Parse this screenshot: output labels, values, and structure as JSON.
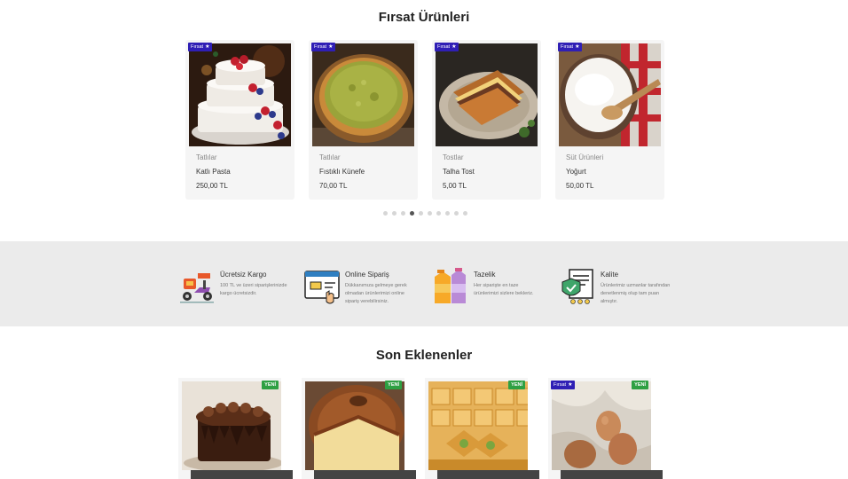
{
  "sections": {
    "firsat_title": "Fırsat Ürünleri",
    "son_title": "Son Eklenenler"
  },
  "badges": {
    "firsat": "Fırsat",
    "yeni": "YENİ"
  },
  "firsat_products": [
    {
      "category": "Tatlılar",
      "name": "Katlı Pasta",
      "price": "250,00 TL",
      "image": "layered-cake"
    },
    {
      "category": "Tatlılar",
      "name": "Fıstıklı Künefe",
      "price": "70,00 TL",
      "image": "kunefe"
    },
    {
      "category": "Tostlar",
      "name": "Talha Tost",
      "price": "5,00 TL",
      "image": "toast"
    },
    {
      "category": "Süt Ürünleri",
      "name": "Yoğurt",
      "price": "50,00 TL",
      "image": "yogurt"
    }
  ],
  "carousel": {
    "page_count": 10,
    "active_index": 3
  },
  "features": [
    {
      "title": "Ücretsiz Kargo",
      "desc": "100 TL ve üzeri siparişlerinizde kargo ücretsizdir.",
      "icon": "delivery-scooter-icon"
    },
    {
      "title": "Online Sipariş",
      "desc": "Dükkanımıza gelmeye gerek olmadan ürünlerimizi online sipariş verebilirsiniz.",
      "icon": "online-order-icon"
    },
    {
      "title": "Tazelik",
      "desc": "Her siparişte en taze ürünlerimizi sizlere bekleriz.",
      "icon": "milk-cartons-icon"
    },
    {
      "title": "Kalite",
      "desc": "Ürünlerimiz uzmanlar tarafından denetlenmiş olup tam puan almıştır.",
      "icon": "quality-certificate-icon"
    }
  ],
  "son_products": [
    {
      "image": "chocolate-cake",
      "badges": [
        "YENİ"
      ]
    },
    {
      "image": "bundt-cake",
      "badges": [
        "YENİ"
      ]
    },
    {
      "image": "baklava",
      "badges": [
        "YENİ"
      ]
    },
    {
      "image": "eggs",
      "badges": [
        "Fırsat",
        "YENİ"
      ]
    }
  ],
  "colors": {
    "firsat_badge": "#2f1fb5",
    "yeni_badge": "#2ea043",
    "features_bg": "#ebebeb"
  }
}
